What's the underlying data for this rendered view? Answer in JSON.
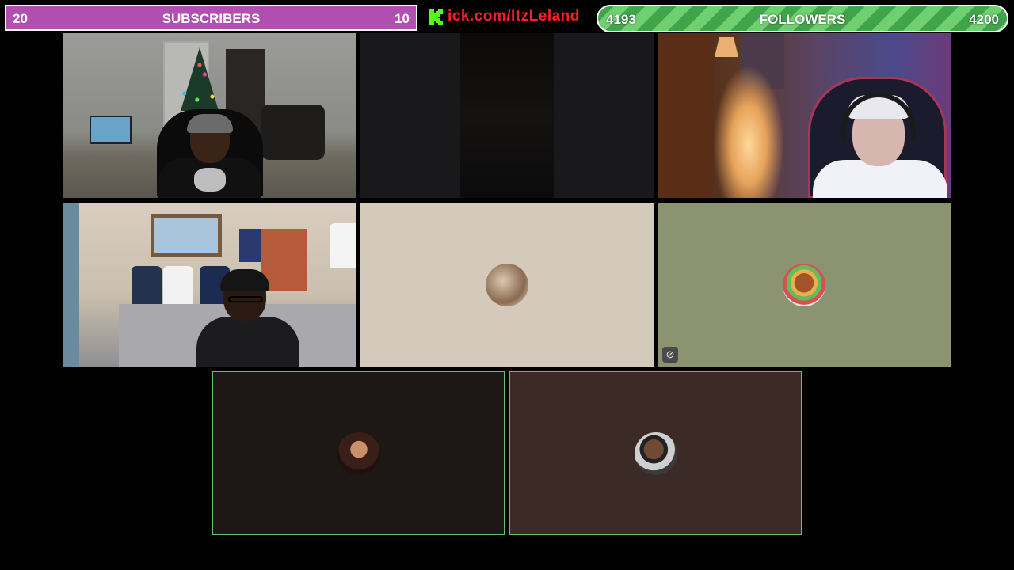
{
  "subscribers": {
    "left_value": "20",
    "label": "SUBSCRIBERS",
    "right_value": "10",
    "color": "#b04fb0"
  },
  "kick": {
    "url": "ick.com/ItzLeland",
    "color": "#ff1f1f",
    "logo_color": "#53fc18",
    "icon": "kick-logo-icon"
  },
  "followers": {
    "left_value": "4193",
    "label": "FOLLOWERS",
    "right_value": "4200",
    "color": "#3fa44a",
    "progress_fraction": 0.9983
  },
  "tiles": [
    {
      "kind": "camera",
      "background": "#8f8f8c"
    },
    {
      "kind": "camera-dark",
      "background": "#19191b"
    },
    {
      "kind": "camera",
      "background": "#4a3a55"
    },
    {
      "kind": "camera",
      "background": "#d2c6b6"
    },
    {
      "kind": "avatar",
      "background": "#d4cabb",
      "avatar_icon": "user-avatar-icon"
    },
    {
      "kind": "avatar",
      "background": "#8c9370",
      "avatar_icon": "user-avatar-icon",
      "status_icon": "camera-off-icon"
    },
    {
      "kind": "avatar",
      "background": "#1e1716",
      "avatar_icon": "user-avatar-icon",
      "active": true,
      "border_color": "#5fc26e"
    },
    {
      "kind": "avatar",
      "background": "#3b2a25",
      "avatar_icon": "user-avatar-icon",
      "active": true,
      "border_color": "#5fc26e"
    }
  ]
}
